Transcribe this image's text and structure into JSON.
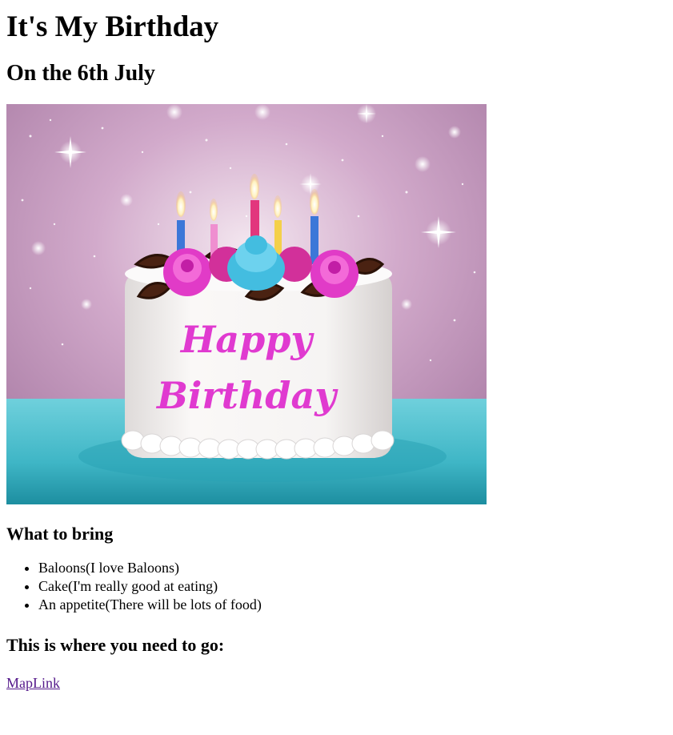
{
  "page": {
    "title": "It's My Birthday",
    "subtitle": "On the 6th July",
    "image": {
      "cake_text_line1": "Happy",
      "cake_text_line2": "Birthday",
      "colors": {
        "background": "#c496bc",
        "table": "#3cbccc",
        "cake": "#f4f2f2",
        "frosting_pink": "#e13bc7",
        "frosting_blue": "#43bde0",
        "lettering": "#e03ad0"
      }
    },
    "bring_heading": "What to bring",
    "bring_items": [
      "Baloons(I love Baloons)",
      "Cake(I'm really good at eating)",
      "An appetite(There will be lots of food)"
    ],
    "directions_heading": "This is where you need to go:",
    "map_link_label": "MapLink"
  }
}
